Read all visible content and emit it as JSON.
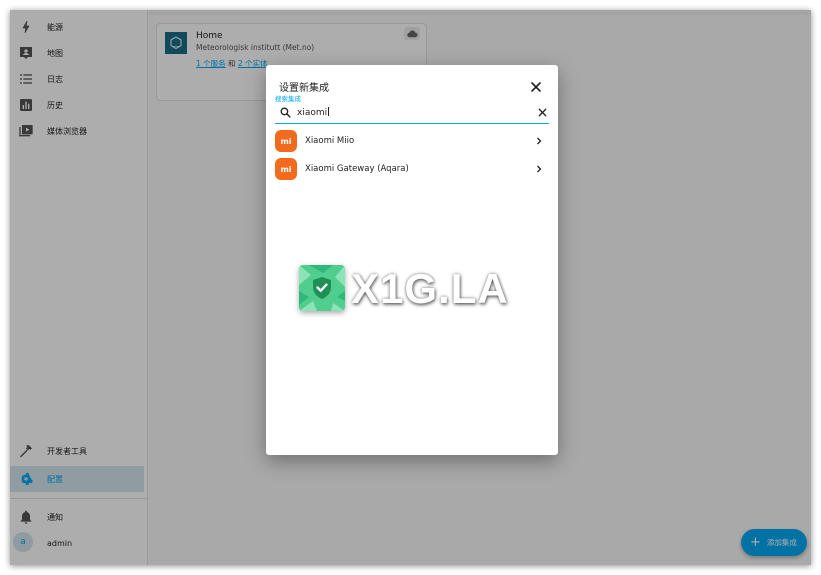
{
  "sidebar": {
    "items": [
      {
        "label": "能源",
        "icon": "lightning-icon"
      },
      {
        "label": "地图",
        "icon": "map-marker-icon"
      },
      {
        "label": "日志",
        "icon": "list-icon"
      },
      {
        "label": "历史",
        "icon": "chart-bar-icon"
      },
      {
        "label": "媒体浏览器",
        "icon": "media-play-icon"
      }
    ],
    "dev_tools": "开发者工具",
    "config": "配置",
    "notifications": "通知",
    "user_initial": "a",
    "user_name": "admin"
  },
  "card": {
    "title": "Home",
    "subtitle": "Meteorologisk institutt (Met.no)",
    "link_services": "1 个服务",
    "and": "和",
    "link_entities": "2 个实体"
  },
  "dialog": {
    "title": "设置新集成",
    "search_label": "搜索集成",
    "search_value": "xiaomi",
    "results": [
      {
        "label": "Xiaomi Miio",
        "logo": "mi"
      },
      {
        "label": "Xiaomi Gateway (Aqara)",
        "logo": "mi"
      }
    ]
  },
  "fab": {
    "label": "添加集成"
  },
  "watermark": {
    "text": "X1G.LA"
  },
  "colors": {
    "accent": "#03a9f4",
    "mi_orange": "#f26a1b",
    "scrim": "rgba(0,0,0,0.32)"
  }
}
